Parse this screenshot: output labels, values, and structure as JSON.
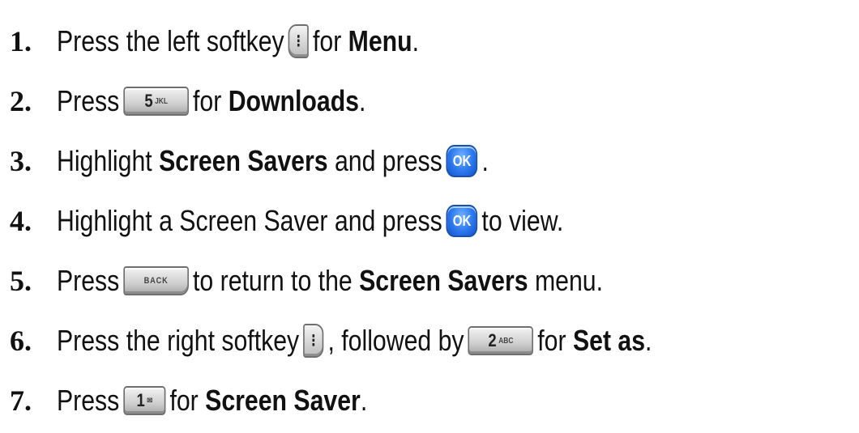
{
  "steps": [
    {
      "number": "1.",
      "t1": "Press the left softkey",
      "key": "⁝",
      "t2": "for",
      "bold": "Menu",
      "t3": "."
    },
    {
      "number": "2.",
      "t1": "Press",
      "key_digit": "5",
      "key_letters": "JKL",
      "t2": "for",
      "bold": "Downloads",
      "t3": "."
    },
    {
      "number": "3.",
      "t1": "Highlight",
      "bold": "Screen Savers",
      "t2": "and press",
      "key": "OK",
      "t3": "."
    },
    {
      "number": "4.",
      "t1": "Highlight a Screen Saver and press",
      "key": "OK",
      "t2": "to view."
    },
    {
      "number": "5.",
      "t1": "Press",
      "key": "BACK",
      "t2": "to return to the",
      "bold": "Screen Savers",
      "t3": "menu."
    },
    {
      "number": "6.",
      "t1": "Press the right softkey",
      "key": "⁝",
      "t2": ", followed by",
      "key2_digit": "2",
      "key2_letters": "ABC",
      "t3": "for",
      "bold": "Set as",
      "t4": "."
    },
    {
      "number": "7.",
      "t1": "Press",
      "key_digit": "1",
      "key_letters": "✉",
      "t2": "for",
      "bold": "Screen Saver",
      "t3": "."
    }
  ],
  "icons": {
    "left_softkey": "left-softkey-icon",
    "right_softkey": "right-softkey-icon",
    "ok": "ok-key-icon",
    "back": "back-key-icon",
    "key5": "key-5-jkl-icon",
    "key2": "key-2-abc-icon",
    "key1": "key-1-voicemail-icon"
  },
  "colors": {
    "text": "#111111",
    "ok_key": "#2c78ee",
    "key_gray": "#cfcfcf"
  }
}
